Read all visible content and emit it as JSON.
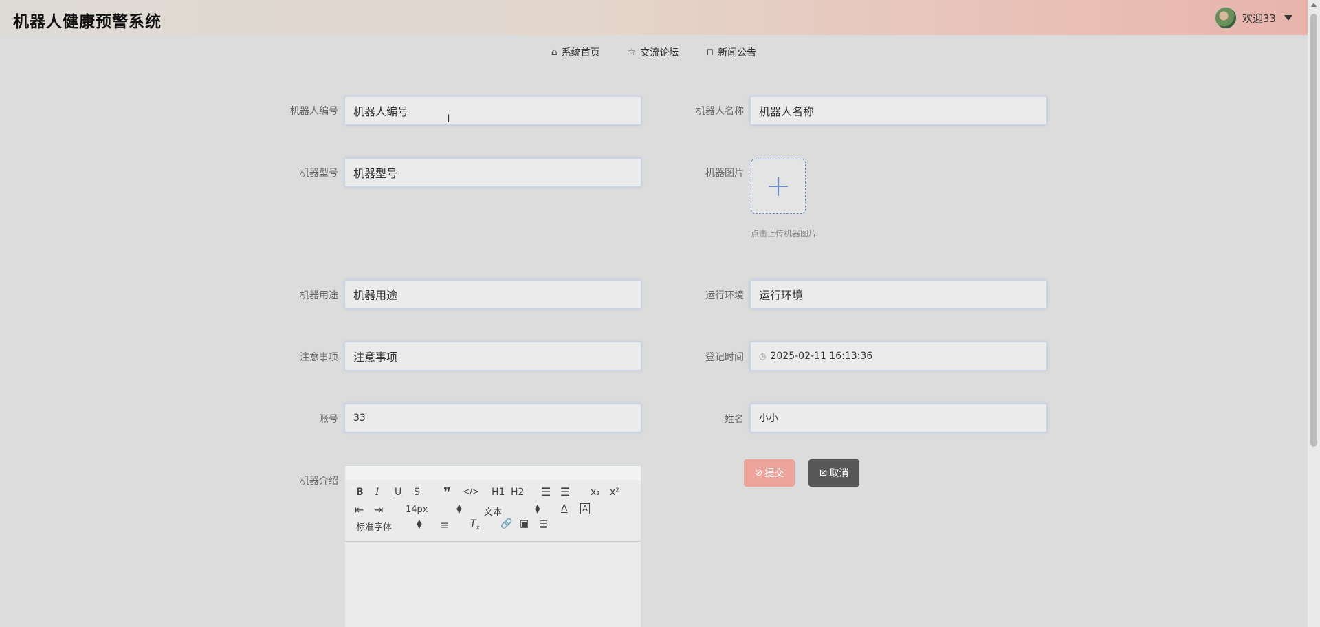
{
  "header": {
    "app_title": "机器人健康预警系统",
    "welcome": "欢迎33"
  },
  "nav": {
    "items": [
      {
        "label": "系统首页",
        "icon": "home-icon"
      },
      {
        "label": "交流论坛",
        "icon": "star-icon"
      },
      {
        "label": "新闻公告",
        "icon": "bag-icon"
      }
    ]
  },
  "form": {
    "robot_no": {
      "label": "机器人编号",
      "placeholder": "机器人编号"
    },
    "robot_name": {
      "label": "机器人名称",
      "placeholder": "机器人名称"
    },
    "model": {
      "label": "机器型号",
      "placeholder": "机器型号"
    },
    "image": {
      "label": "机器图片",
      "hint": "点击上传机器图片"
    },
    "usage": {
      "label": "机器用途",
      "placeholder": "机器用途"
    },
    "environment": {
      "label": "运行环境",
      "placeholder": "运行环境"
    },
    "notes": {
      "label": "注意事项",
      "placeholder": "注意事项"
    },
    "register_time": {
      "label": "登记时间",
      "value": "2025-02-11 16:13:36"
    },
    "account": {
      "label": "账号",
      "value": "33"
    },
    "name": {
      "label": "姓名",
      "value": "小小"
    },
    "intro": {
      "label": "机器介绍"
    }
  },
  "buttons": {
    "submit": "提交",
    "cancel": "取消"
  },
  "editor": {
    "font_size": "14px",
    "block_type": "文本",
    "font_family": "标准字体",
    "h1": "H1",
    "h2": "H2"
  },
  "colors": {
    "submit_bg": "#eda59b",
    "cancel_bg": "#585858",
    "accent": "#6b8dc8"
  }
}
